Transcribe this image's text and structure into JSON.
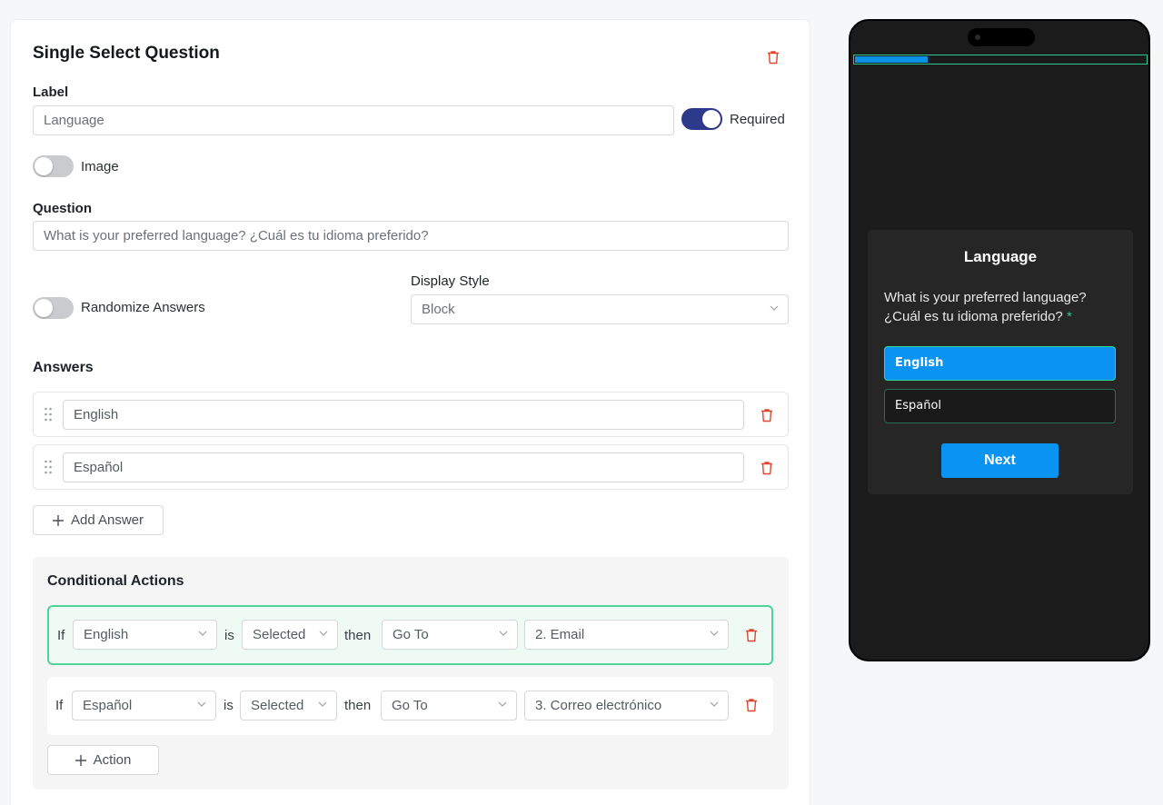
{
  "editor": {
    "title": "Single Select Question",
    "label_heading": "Label",
    "label_value": "Language",
    "required_label": "Required",
    "required_on": true,
    "image_label": "Image",
    "image_on": false,
    "question_heading": "Question",
    "question_value": "What is your preferred language? ¿Cuál es tu idioma preferido?",
    "randomize_label": "Randomize Answers",
    "randomize_on": false,
    "display_style_heading": "Display Style",
    "display_style_value": "Block",
    "answers_heading": "Answers",
    "answers": [
      "English",
      "Español"
    ],
    "add_answer_label": "Add Answer"
  },
  "conditional": {
    "heading": "Conditional Actions",
    "word_if": "If",
    "word_is": "is",
    "word_then": "then",
    "rows": [
      {
        "answer": "English",
        "condition": "Selected",
        "action": "Go To",
        "target": "2. Email"
      },
      {
        "answer": "Español",
        "condition": "Selected",
        "action": "Go To",
        "target": "3. Correo electrónico"
      }
    ],
    "add_action_label": "Action"
  },
  "preview": {
    "progress_fraction": 0.25,
    "title": "Language",
    "question_line1": "What is your preferred language?",
    "question_line2": "¿Cuál es tu idioma preferido?",
    "required_marker": "*",
    "options": [
      "English",
      "Español"
    ],
    "selected_option": "English",
    "next_label": "Next"
  },
  "colors": {
    "accent_toggle": "#2d3a8c",
    "delete_red": "#e0452e",
    "preview_blue": "#0a93f0",
    "preview_green": "#2ac88e",
    "active_row_border": "#4ed39a"
  },
  "icons": [
    "trash-icon",
    "chevron-down-icon",
    "drag-handle-icon",
    "plus-icon"
  ]
}
